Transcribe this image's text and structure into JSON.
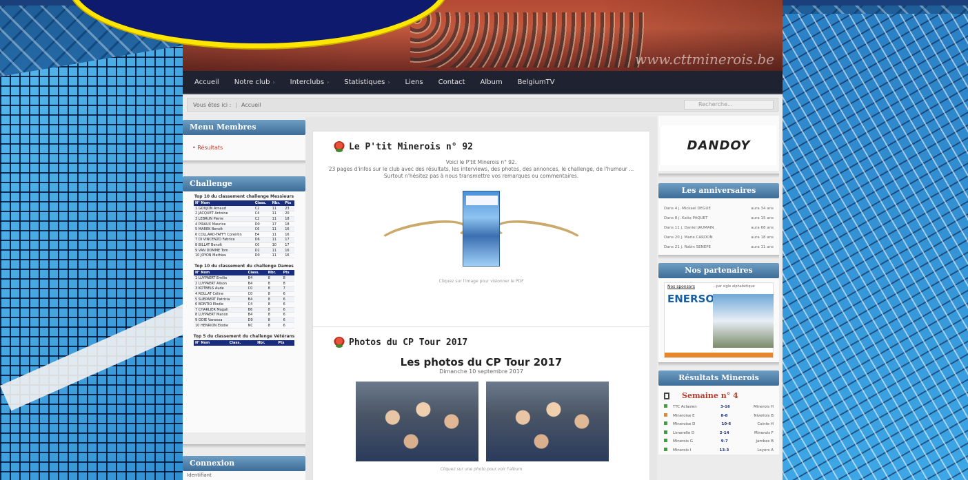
{
  "banner": {
    "url_text": "www.cttminerois.be"
  },
  "nav": {
    "items": [
      {
        "label": "Accueil",
        "arrow": false
      },
      {
        "label": "Notre club",
        "arrow": true
      },
      {
        "label": "Interclubs",
        "arrow": true
      },
      {
        "label": "Statistiques",
        "arrow": true
      },
      {
        "label": "Liens",
        "arrow": false
      },
      {
        "label": "Contact",
        "arrow": false
      },
      {
        "label": "Album",
        "arrow": false
      },
      {
        "label": "BelgiumTV",
        "arrow": false
      }
    ]
  },
  "breadcrumb": {
    "prefix": "Vous êtes ici :",
    "current": "Accueil",
    "search_placeholder": "Recherche..."
  },
  "left": {
    "members_title": "Menu Membres",
    "members_link": "Résultats",
    "challenge_title": "Challenge",
    "t1_title": "Top 10 du classement challenge Messieurs",
    "t1_headers": [
      "N° Nom",
      "Class.",
      "Nbr.",
      "Pts"
    ],
    "t1_rows": [
      [
        "1 GOUJON Arnaud",
        "C2",
        "11",
        "23"
      ],
      [
        "2 JACQUET Antoine",
        "C4",
        "11",
        "20"
      ],
      [
        "3 LEBRUN Pierre",
        "C2",
        "11",
        "18"
      ],
      [
        "4 PIRAUX Maurice",
        "D0",
        "17",
        "18"
      ],
      [
        "5 MAREK Benoît",
        "C6",
        "11",
        "16"
      ],
      [
        "6 COLLARD-TAFFY Corentin",
        "E4",
        "11",
        "16"
      ],
      [
        "7 DI VINCENZO Fabrice",
        "D6",
        "11",
        "17"
      ],
      [
        "8 BILLAT Benoît",
        "C0",
        "10",
        "17"
      ],
      [
        "9 VAN DOMME Tom",
        "D2",
        "11",
        "16"
      ],
      [
        "10 JOYON Mathieu",
        "D0",
        "11",
        "16"
      ]
    ],
    "t2_title": "Top 10 du classement du challenge Dames",
    "t2_headers": [
      "N° Nom",
      "Class.",
      "Nbr.",
      "Pts"
    ],
    "t2_rows": [
      [
        "1 LUYPAERT Emilie",
        "B4",
        "8",
        "8"
      ],
      [
        "2 LUYPAERT Alison",
        "B4",
        "8",
        "8"
      ],
      [
        "3 KOTBELS Aude",
        "C0",
        "8",
        "7"
      ],
      [
        "4 ROLLAT Céline",
        "C0",
        "8",
        "6"
      ],
      [
        "5 SUEPAERT Patricia",
        "B4",
        "8",
        "6"
      ],
      [
        "6 BONTIO Elodie",
        "C4",
        "8",
        "6"
      ],
      [
        "7 CHARLIER Magali",
        "B6",
        "8",
        "6"
      ],
      [
        "8 LUYPAERT Manon",
        "B4",
        "8",
        "6"
      ],
      [
        "9 GOIE Vanessa",
        "D0",
        "8",
        "6"
      ],
      [
        "10 HENRION Elodie",
        "NC",
        "8",
        "6"
      ]
    ],
    "t3_title": "Top 5 du classement du challenge Vétérans",
    "t3_headers": [
      "N° Nom",
      "Class.",
      "Nbr.",
      "Pts"
    ],
    "login_title": "Connexion",
    "login_label": "Identifiant"
  },
  "main": {
    "a1_title": "Le P'tit Minerois n° 92",
    "a1_line1": "Voici le P'tit Minerois n° 92.",
    "a1_line2": "23 pages d'infos sur le club avec des résultats, les interviews, des photos, des annonces, le challenge, de l'humour ...",
    "a1_line3": "Surtout n'hésitez pas à nous transmettre vos remarques ou commentaires.",
    "a1_caption": "Cliquez sur l'image pour visionner le PDF",
    "a2_title": "Photos du CP Tour 2017",
    "a2_heading": "Les photos du CP Tour 2017",
    "a2_date": "Dimanche 10 septembre 2017",
    "a2_caption": "Cliquez sur une photo pour voir l'album"
  },
  "right": {
    "sponsor_name": "DANDOY",
    "bday_title": "Les anniversaires",
    "bdays": [
      [
        "Dans 4 j. Mickael DEGUE",
        "aura 34 ans"
      ],
      [
        "Dans 8 j. Katia PAQUET",
        "aura 15 ans"
      ],
      [
        "Dans 11 j. Daniel JAUMAIN",
        "aura 68 ans"
      ],
      [
        "Dans 20 j. Marie CARDON",
        "aura 18 ans"
      ],
      [
        "Dans 21 j. Robin SENEPE",
        "aura 11 ans"
      ]
    ],
    "partners_title": "Nos partenaires",
    "partners_tag": "Nos sponsors",
    "partners_tag2": "...par sigle alphabétique",
    "partner_name": "ENERSOL",
    "results_title": "Résultats Minerois",
    "week_label": "Semaine n° 4",
    "results": [
      {
        "home": "TTC Aclasien",
        "score": "3-16",
        "away": "Minerois H",
        "color": "#3aa23a"
      },
      {
        "home": "Mineroise E",
        "score": "8-8",
        "away": "Nivellois B",
        "color": "#e6872e"
      },
      {
        "home": "Mineroise D",
        "score": "10-6",
        "away": "Cointe H",
        "color": "#3aa23a"
      },
      {
        "home": "Limerelle D",
        "score": "2-14",
        "away": "Minerois F",
        "color": "#3aa23a"
      },
      {
        "home": "Minerois G",
        "score": "9-7",
        "away": "Jambes B",
        "color": "#3aa23a"
      },
      {
        "home": "Minerois I",
        "score": "13-3",
        "away": "Loyers A",
        "color": "#3aa23a"
      }
    ]
  }
}
